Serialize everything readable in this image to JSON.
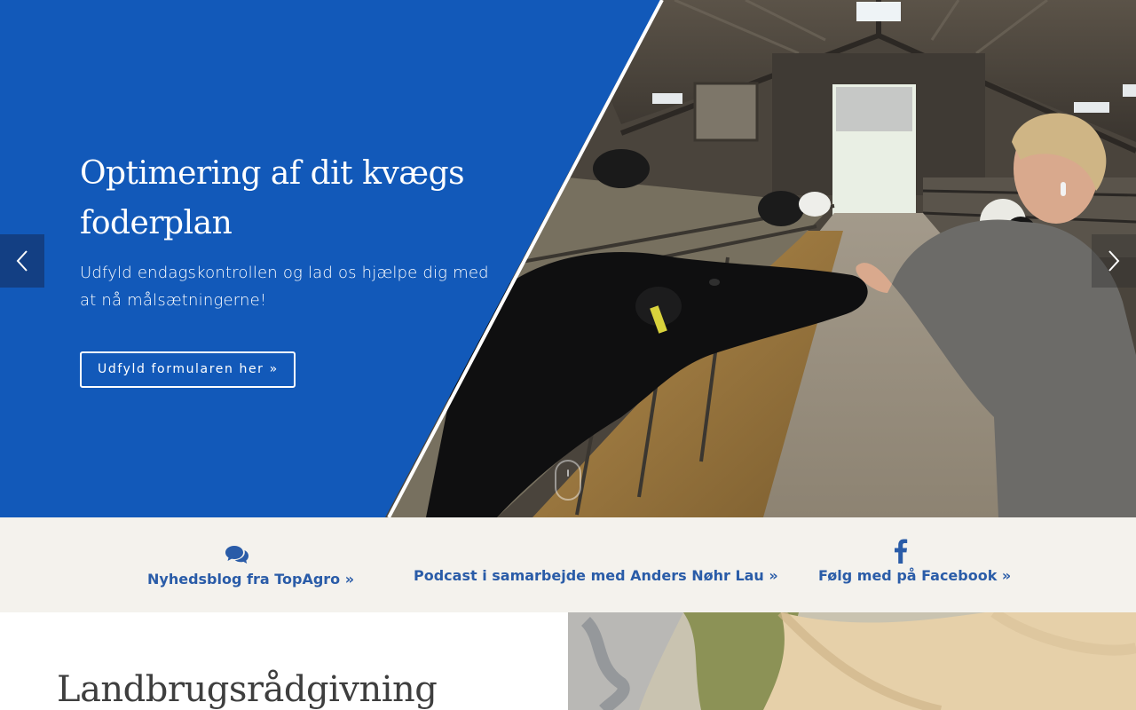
{
  "hero": {
    "title": "Optimering af dit kvægs foderplan",
    "subtitle": "Udfyld endagskontrollen og lad os hjælpe dig med at nå målsætningerne!",
    "cta_label": "Udfyld formularen her »",
    "prev_icon": "chevron-left-icon",
    "next_icon": "chevron-right-icon",
    "brand_color": "#1259b9"
  },
  "links": [
    {
      "label": "Nyhedsblog fra TopAgro »",
      "icon": "comments-icon"
    },
    {
      "label": "Podcast i samarbejde med Anders Nøhr Lau »",
      "icon": ""
    },
    {
      "label": "Følg med på Facebook »",
      "icon": "facebook-icon"
    }
  ],
  "section": {
    "title": "Landbrugsrådgivning"
  },
  "colors": {
    "link": "#2a5ca8",
    "bar_bg": "#f4f2ed",
    "heading": "#3e3e3e"
  }
}
